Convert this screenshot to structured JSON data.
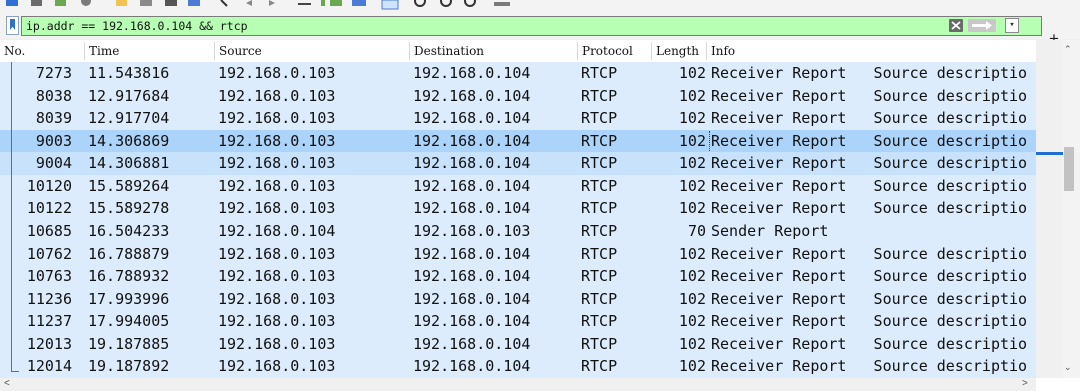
{
  "toolbar": {
    "icons": [
      "shark-fin-icon",
      "stop-icon",
      "restart-icon",
      "options-icon",
      "open-file-icon",
      "save-file-icon",
      "close-file-icon",
      "reload-icon",
      "find-packet-icon",
      "go-back-icon",
      "go-forward-icon",
      "go-to-packet-icon",
      "go-first-icon",
      "go-last-icon",
      "autoscroll-icon",
      "colorize-icon",
      "zoom-in-icon",
      "zoom-out-icon",
      "normal-size-icon",
      "resize-columns-icon"
    ]
  },
  "filter": {
    "value": "ip.addr == 192.168.0.104 && rtcp",
    "bg_color": "#b7ffb3"
  },
  "columns": {
    "no": "No.",
    "time": "Time",
    "source": "Source",
    "destination": "Destination",
    "protocol": "Protocol",
    "length": "Length",
    "info": "Info"
  },
  "packets": [
    {
      "no": "7273",
      "time": "11.543816",
      "src": "192.168.0.103",
      "dst": "192.168.0.104",
      "proto": "RTCP",
      "len": "102",
      "info": "Receiver Report   Source descriptio"
    },
    {
      "no": "8038",
      "time": "12.917684",
      "src": "192.168.0.103",
      "dst": "192.168.0.104",
      "proto": "RTCP",
      "len": "102",
      "info": "Receiver Report   Source descriptio"
    },
    {
      "no": "8039",
      "time": "12.917704",
      "src": "192.168.0.103",
      "dst": "192.168.0.104",
      "proto": "RTCP",
      "len": "102",
      "info": "Receiver Report   Source descriptio"
    },
    {
      "no": "9003",
      "time": "14.306869",
      "src": "192.168.0.103",
      "dst": "192.168.0.104",
      "proto": "RTCP",
      "len": "102",
      "info": "Receiver Report   Source descriptio"
    },
    {
      "no": "9004",
      "time": "14.306881",
      "src": "192.168.0.103",
      "dst": "192.168.0.104",
      "proto": "RTCP",
      "len": "102",
      "info": "Receiver Report   Source descriptio"
    },
    {
      "no": "10120",
      "time": "15.589264",
      "src": "192.168.0.103",
      "dst": "192.168.0.104",
      "proto": "RTCP",
      "len": "102",
      "info": "Receiver Report   Source descriptio"
    },
    {
      "no": "10122",
      "time": "15.589278",
      "src": "192.168.0.103",
      "dst": "192.168.0.104",
      "proto": "RTCP",
      "len": "102",
      "info": "Receiver Report   Source descriptio"
    },
    {
      "no": "10685",
      "time": "16.504233",
      "src": "192.168.0.104",
      "dst": "192.168.0.103",
      "proto": "RTCP",
      "len": "70",
      "info": "Sender Report"
    },
    {
      "no": "10762",
      "time": "16.788879",
      "src": "192.168.0.103",
      "dst": "192.168.0.104",
      "proto": "RTCP",
      "len": "102",
      "info": "Receiver Report   Source descriptio"
    },
    {
      "no": "10763",
      "time": "16.788932",
      "src": "192.168.0.103",
      "dst": "192.168.0.104",
      "proto": "RTCP",
      "len": "102",
      "info": "Receiver Report   Source descriptio"
    },
    {
      "no": "11236",
      "time": "17.993996",
      "src": "192.168.0.103",
      "dst": "192.168.0.104",
      "proto": "RTCP",
      "len": "102",
      "info": "Receiver Report   Source descriptio"
    },
    {
      "no": "11237",
      "time": "17.994005",
      "src": "192.168.0.103",
      "dst": "192.168.0.104",
      "proto": "RTCP",
      "len": "102",
      "info": "Receiver Report   Source descriptio"
    },
    {
      "no": "12013",
      "time": "19.187885",
      "src": "192.168.0.103",
      "dst": "192.168.0.104",
      "proto": "RTCP",
      "len": "102",
      "info": "Receiver Report   Source descriptio"
    },
    {
      "no": "12014",
      "time": "19.187892",
      "src": "192.168.0.103",
      "dst": "192.168.0.104",
      "proto": "RTCP",
      "len": "102",
      "info": "Receiver Report   Source descriptio"
    }
  ],
  "selected_packet": "9003",
  "colors": {
    "row_bg": "#dcecfc",
    "selected_bg": "#acd4fb",
    "related_bg": "#c9e2fb",
    "scroll_marker": "#1f6fd1"
  }
}
